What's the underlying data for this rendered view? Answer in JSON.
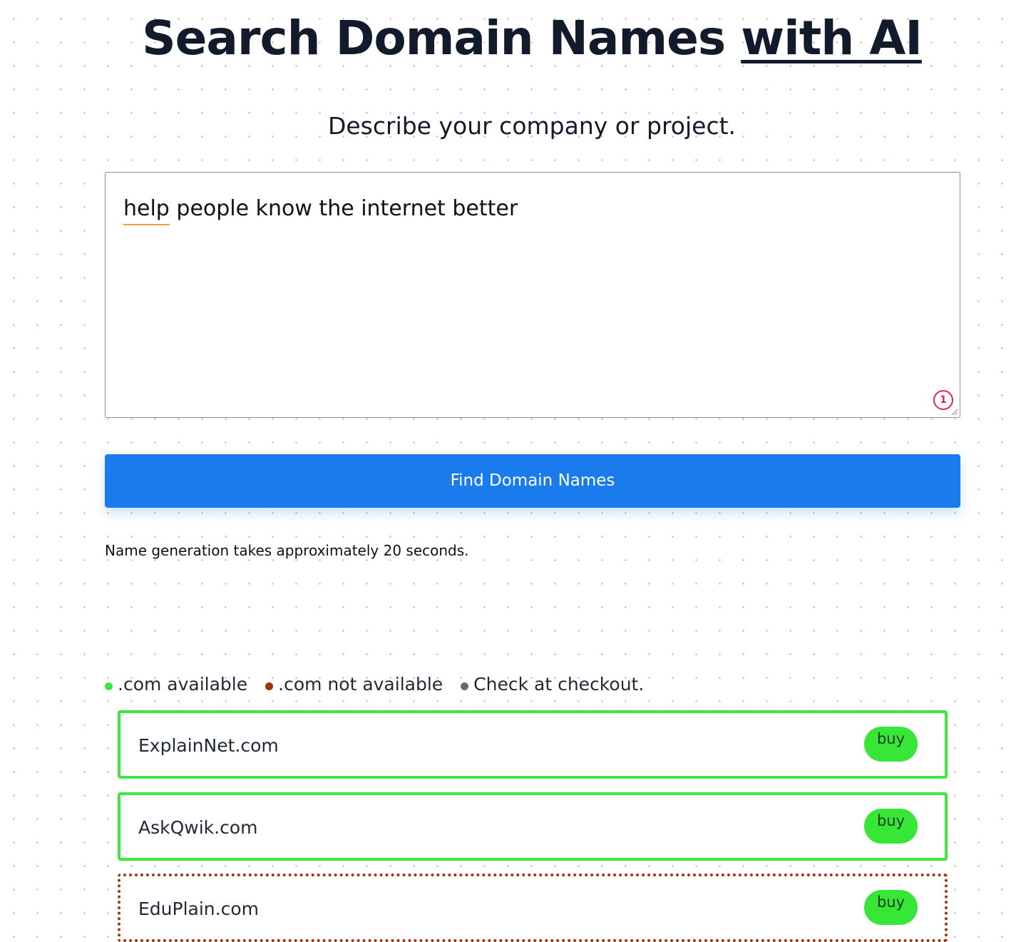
{
  "header": {
    "title_main": "Search Domain Names ",
    "title_emphasis": "with AI",
    "subtitle": "Describe your company or project."
  },
  "input": {
    "value_first_word": "help",
    "value_rest": " people know the internet better",
    "error_count": "1"
  },
  "search_button": {
    "label": "Find Domain Names"
  },
  "note": "Name generation takes approximately 20 seconds.",
  "legend": {
    "available_label": ".com available",
    "not_available_label": ".com not available",
    "check_label": "Check at checkout.",
    "colors": {
      "available": "#3ee63e",
      "not_available": "#9c3415",
      "check": "#6b6b6b"
    }
  },
  "results": [
    {
      "domain": "ExplainNet.com",
      "status": "available",
      "buy_label": "buy"
    },
    {
      "domain": "AskQwik.com",
      "status": "available",
      "buy_label": "buy"
    },
    {
      "domain": "EduPlain.com",
      "status": "not available",
      "buy_label": "buy"
    }
  ],
  "colors": {
    "primary_button": "#197bec",
    "buy_button": "#38e638",
    "title_text": "#111b2b",
    "error_badge": "#e0245e"
  }
}
